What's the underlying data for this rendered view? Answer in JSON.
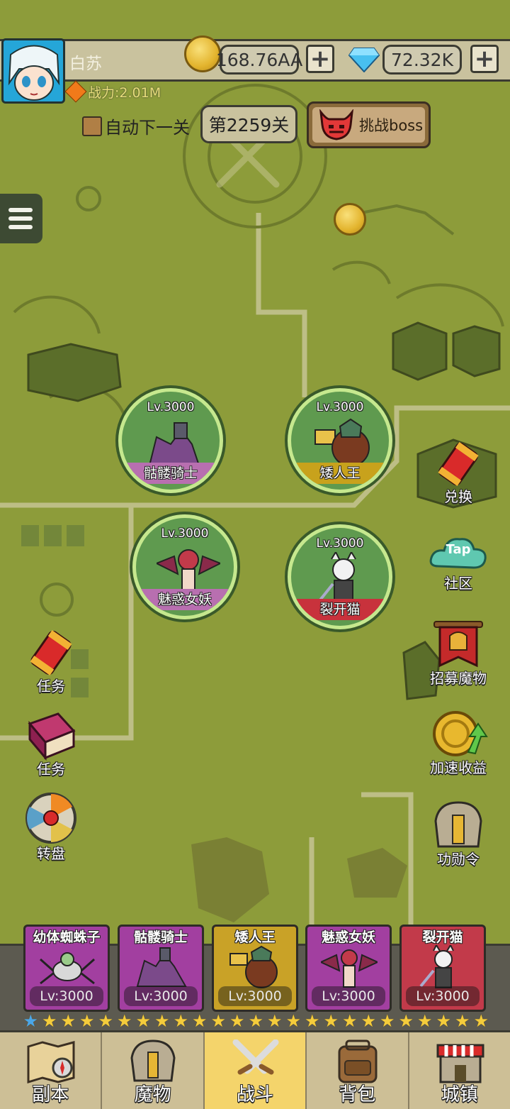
{
  "player": {
    "name": "白苏",
    "power": "战力:2.01M"
  },
  "currency": {
    "gold": "168.76AA",
    "gems": "72.32K",
    "plus": "+"
  },
  "stage": {
    "auto_next_label": "自动下一关",
    "current": "第2259关",
    "boss_label": "挑战boss"
  },
  "monsters": [
    {
      "level": "Lv.3000",
      "name": "骷髅骑士",
      "band": "#b86fb0"
    },
    {
      "level": "Lv.3000",
      "name": "矮人王",
      "band": "#c8a21c"
    },
    {
      "level": "Lv.3000",
      "name": "魅惑女妖",
      "band": "#b86fb0"
    },
    {
      "level": "Lv.3000",
      "name": "裂开猫",
      "band": "#c8323c"
    }
  ],
  "side_left": [
    {
      "label": "任务",
      "icon": "firecracker-scroll-icon"
    },
    {
      "label": "任务",
      "icon": "red-book-icon"
    },
    {
      "label": "转盘",
      "icon": "wheel-icon"
    }
  ],
  "side_right": [
    {
      "label": "兑换",
      "icon": "firecracker-scroll-icon"
    },
    {
      "label": "社区",
      "icon": "tap-cloud-icon",
      "badge": "Tap"
    },
    {
      "label": "招募魔物",
      "icon": "banner-helmet-icon"
    },
    {
      "label": "加速收益",
      "icon": "coin-arrow-icon"
    },
    {
      "label": "功勋令",
      "icon": "helmet-icon"
    }
  ],
  "team": [
    {
      "name": "幼体蜘蛛子",
      "level": "Lv:3000",
      "bg": "#a23fa0"
    },
    {
      "name": "骷髅骑士",
      "level": "Lv:3000",
      "bg": "#a23fa0"
    },
    {
      "name": "矮人王",
      "level": "Lv:3000",
      "bg": "#c9a227"
    },
    {
      "name": "魅惑女妖",
      "level": "Lv:3000",
      "bg": "#a23fa0"
    },
    {
      "name": "裂开猫",
      "level": "Lv:3000",
      "bg": "#c23a4a"
    }
  ],
  "stars": {
    "blue_count": 1,
    "gold_count": 24
  },
  "nav": [
    {
      "label": "副本",
      "icon": "map-compass-icon",
      "active": false
    },
    {
      "label": "魔物",
      "icon": "helmet-icon",
      "active": false
    },
    {
      "label": "战斗",
      "icon": "crossed-swords-icon",
      "active": true
    },
    {
      "label": "背包",
      "icon": "backpack-icon",
      "active": false
    },
    {
      "label": "城镇",
      "icon": "shop-icon",
      "active": false
    }
  ]
}
